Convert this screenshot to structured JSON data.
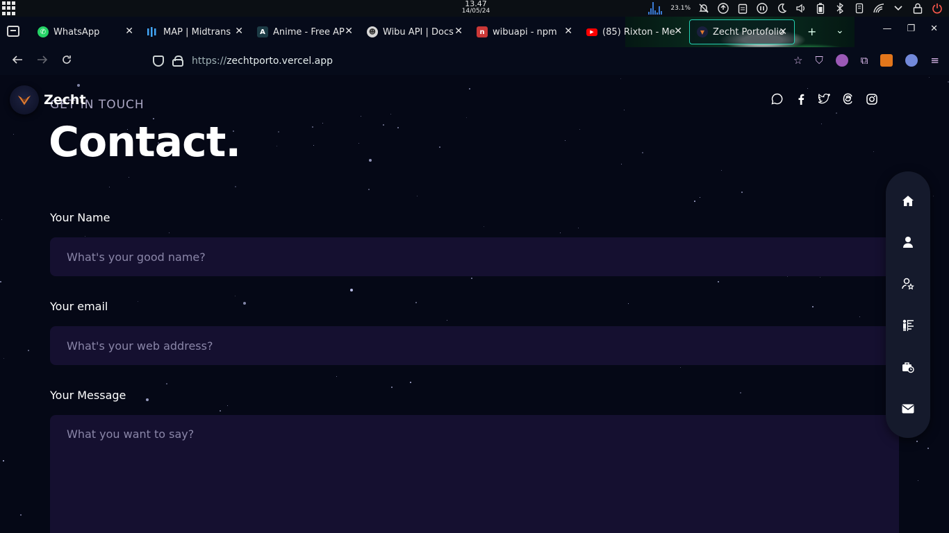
{
  "os": {
    "time": "13.47",
    "date": "14/05/24",
    "cpu_percent": "23.1%"
  },
  "browser": {
    "tabs": [
      {
        "title": "WhatsApp",
        "favicon": "whatsapp-icon",
        "color": "#25d366"
      },
      {
        "title": "MAP | Midtrans",
        "favicon": "midtrans-icon",
        "color": "#1e88e5"
      },
      {
        "title": "Anime - Free AP",
        "favicon": "anime-api-icon",
        "color": "#1c3b45"
      },
      {
        "title": "Wibu API | Docs",
        "favicon": "wibu-api-icon",
        "color": "#888888"
      },
      {
        "title": "wibuapi - npm",
        "favicon": "npm-icon",
        "color": "#cb3837"
      },
      {
        "title": "(85) Rixton - Me",
        "favicon": "youtube-icon",
        "color": "#ff0000"
      },
      {
        "title": "Zecht Portofolio",
        "favicon": "zecht-icon",
        "color": "#1a1f3d",
        "active": true
      }
    ],
    "url_scheme": "https://",
    "url_host": "zechtporto.vercel.app"
  },
  "site": {
    "brand": "Zecht",
    "subtitle": "GET IN TOUCH",
    "title": "Contact.",
    "form": {
      "name_label": "Your Name",
      "name_placeholder": "What's your good name?",
      "email_label": "Your email",
      "email_placeholder": "What's your web address?",
      "message_label": "Your Message",
      "message_placeholder": "What you want to say?"
    },
    "socials": [
      "whatsapp-icon",
      "facebook-icon",
      "twitter-icon",
      "threads-icon",
      "instagram-icon"
    ],
    "side_nav": [
      "home-icon",
      "user-icon",
      "user-star-icon",
      "skills-icon",
      "briefcase-clock-icon",
      "mail-icon"
    ]
  },
  "colors": {
    "background": "#050816",
    "input_bg": "#151030",
    "placeholder": "#8a86a8",
    "accent_tab": "#23d1b3"
  }
}
